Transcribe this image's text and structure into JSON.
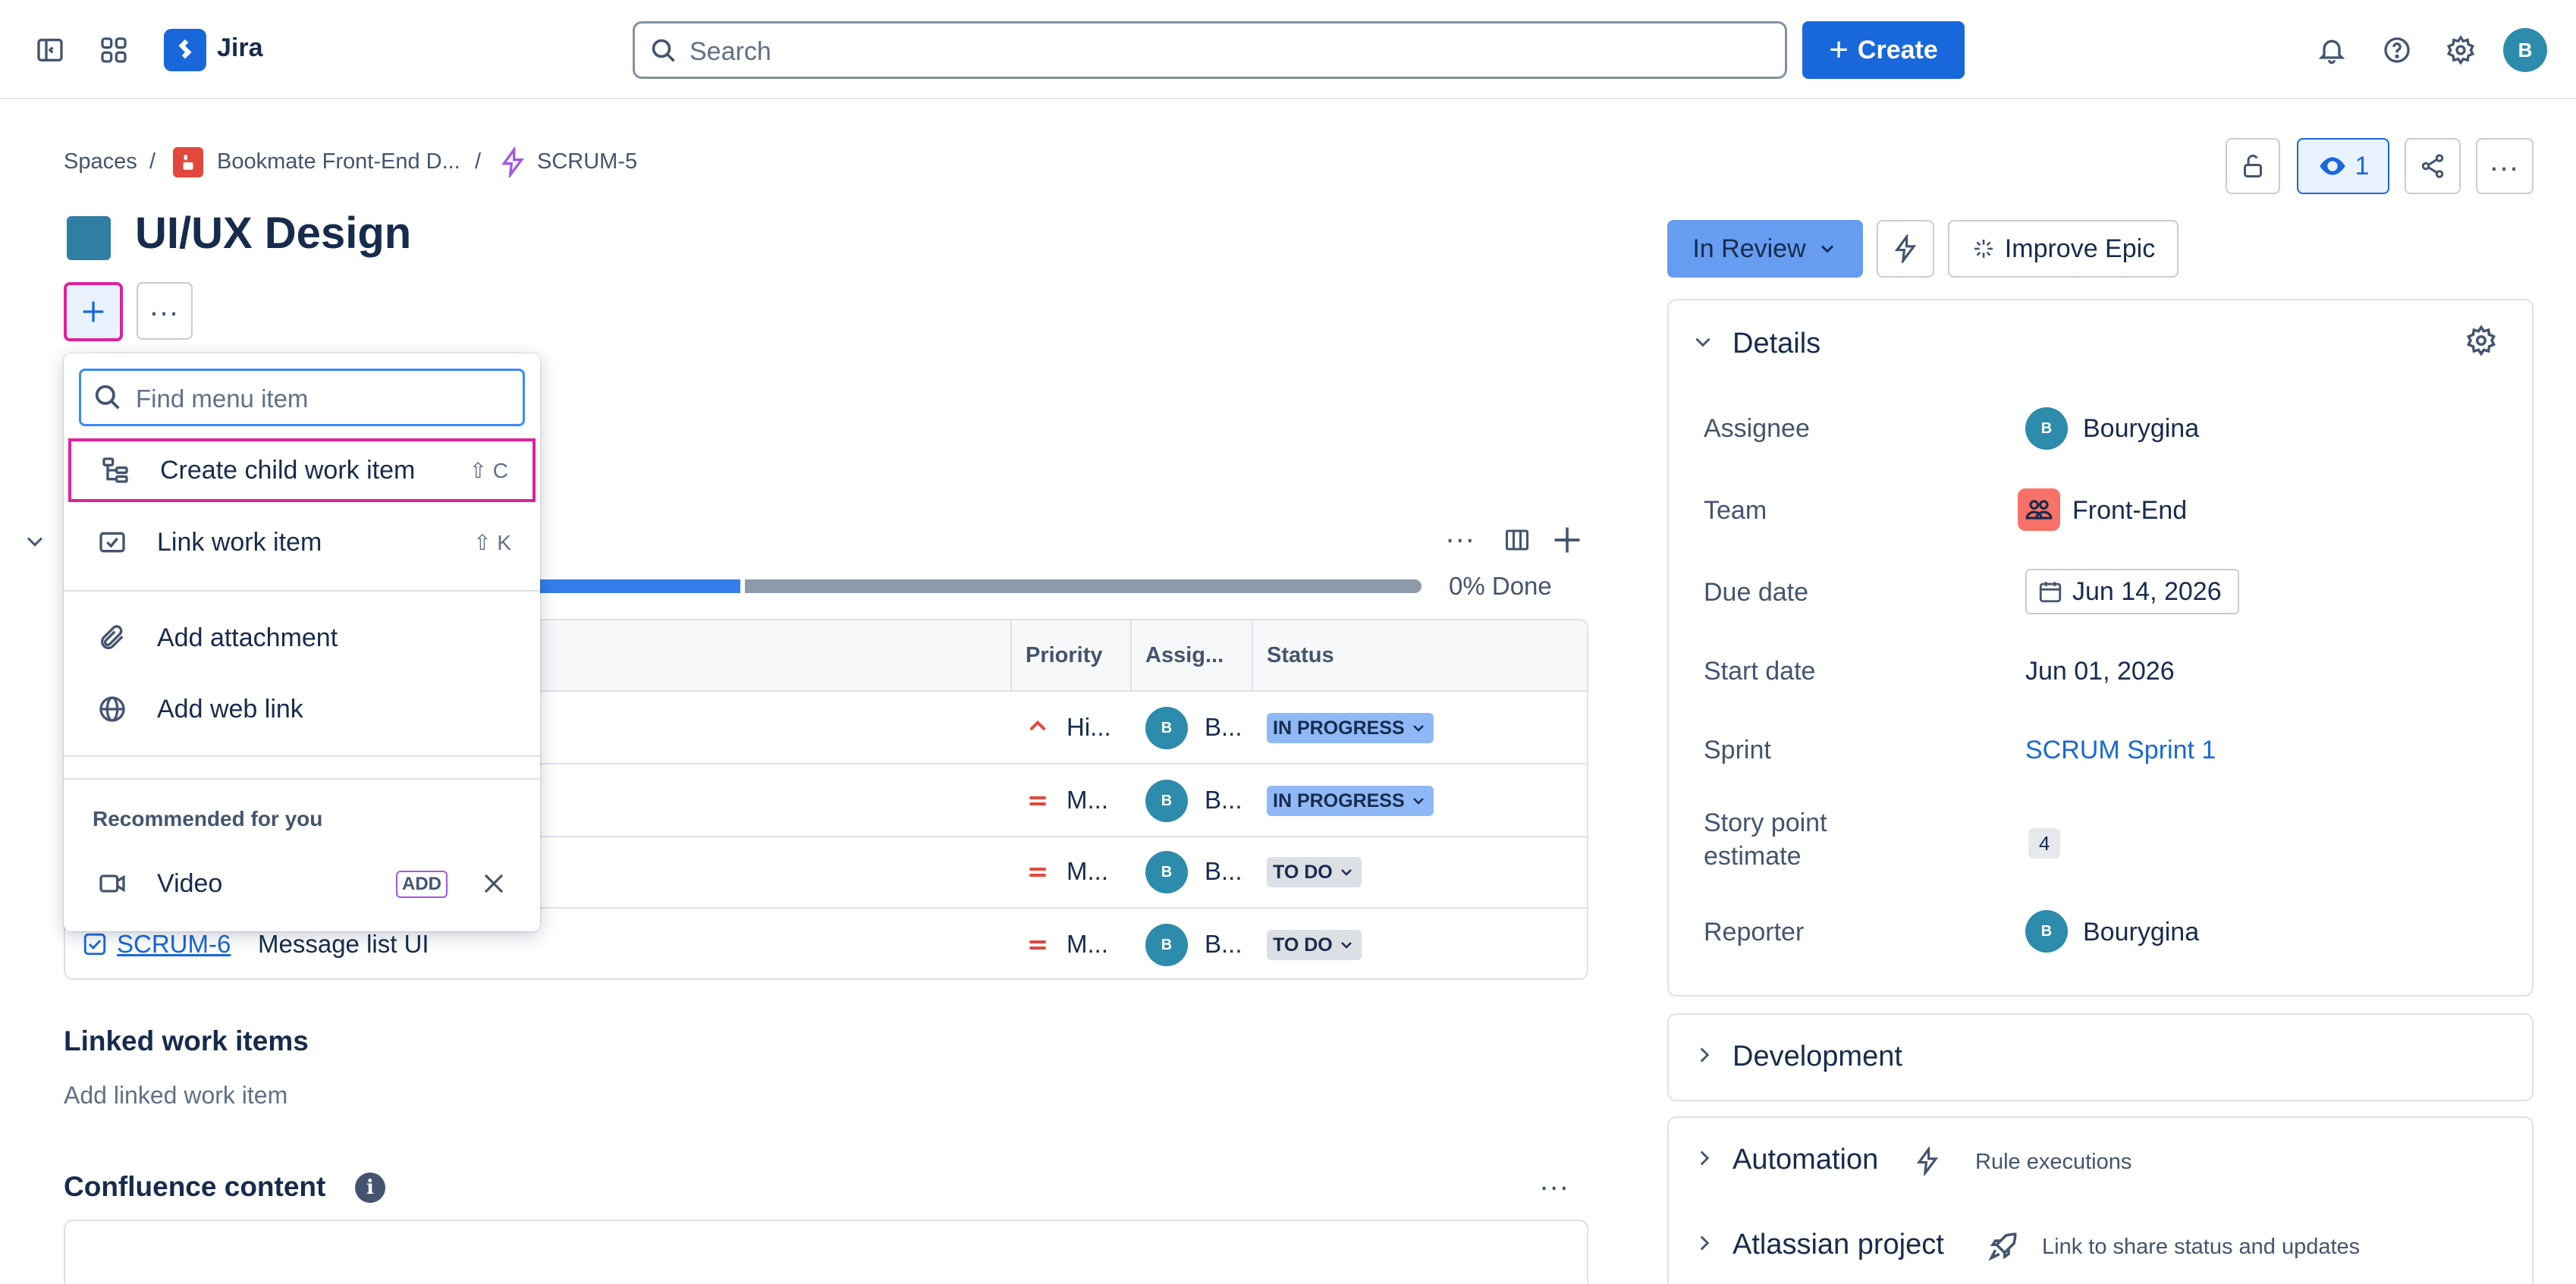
{
  "topbar": {
    "app_name": "Jira",
    "search_placeholder": "Search",
    "create_label": "Create",
    "avatar_initial": "B"
  },
  "breadcrumb": {
    "spaces": "Spaces",
    "sep": "/",
    "project": "Bookmate Front-End D...",
    "issue_key": "SCRUM-5"
  },
  "header_actions": {
    "watchers_count": "1"
  },
  "epic": {
    "title": "UI/UX Design",
    "color": "#2f7ea3"
  },
  "menu": {
    "search_placeholder": "Find menu item",
    "items": [
      {
        "label": "Create child work item",
        "shortcut": "⇧ C",
        "icon": "child-item-icon"
      },
      {
        "label": "Link work item",
        "shortcut": "⇧ K",
        "icon": "link-item-icon"
      },
      {
        "label": "Add attachment",
        "shortcut": "",
        "icon": "paperclip-icon"
      },
      {
        "label": "Add web link",
        "shortcut": "",
        "icon": "globe-icon"
      }
    ],
    "recommended_heading": "Recommended for you",
    "recommended": {
      "label": "Video",
      "badge": "ADD",
      "icon": "video-icon"
    }
  },
  "progress": {
    "done_label": "0% Done",
    "in_progress_fraction": 0.5,
    "done_fraction": 0.0
  },
  "table": {
    "headers": {
      "priority": "Priority",
      "assignee": "Assig...",
      "status": "Status"
    },
    "rows": [
      {
        "priority": "Hi...",
        "priority_level": "high",
        "assignee_initial": "B",
        "assignee": "B...",
        "status": "IN PROGRESS",
        "status_type": "progress"
      },
      {
        "priority": "M...",
        "priority_level": "medium",
        "assignee_initial": "B",
        "assignee": "B...",
        "status": "IN PROGRESS",
        "status_type": "progress"
      },
      {
        "priority": "M...",
        "priority_level": "medium",
        "assignee_initial": "B",
        "assignee": "B...",
        "status": "TO DO",
        "status_type": "todo"
      },
      {
        "key": "SCRUM-6",
        "summary": "Message list UI",
        "priority": "M...",
        "priority_level": "medium",
        "assignee_initial": "B",
        "assignee": "B...",
        "status": "TO DO",
        "status_type": "todo"
      }
    ]
  },
  "linked": {
    "heading": "Linked work items",
    "add_label": "Add linked work item"
  },
  "confluence": {
    "heading": "Confluence content"
  },
  "right": {
    "status_label": "In Review",
    "improve_label": "Improve Epic",
    "details_heading": "Details",
    "fields": {
      "assignee_label": "Assignee",
      "assignee_value": "Bourygina",
      "assignee_initial": "B",
      "team_label": "Team",
      "team_value": "Front-End",
      "due_label": "Due date",
      "due_value": "Jun 14, 2026",
      "start_label": "Start date",
      "start_value": "Jun 01, 2026",
      "sprint_label": "Sprint",
      "sprint_value": "SCRUM Sprint 1",
      "story_label_1": "Story point",
      "story_label_2": "estimate",
      "story_value": "4",
      "reporter_label": "Reporter",
      "reporter_value": "Bourygina",
      "reporter_initial": "B"
    },
    "development_heading": "Development",
    "automation_heading": "Automation",
    "automation_sub": "Rule executions",
    "atlassian_heading": "Atlassian project",
    "atlassian_sub": "Link to share status and updates"
  },
  "colors": {
    "brand": "#1868db",
    "highlight": "#e0219b",
    "link": "#1868db"
  }
}
